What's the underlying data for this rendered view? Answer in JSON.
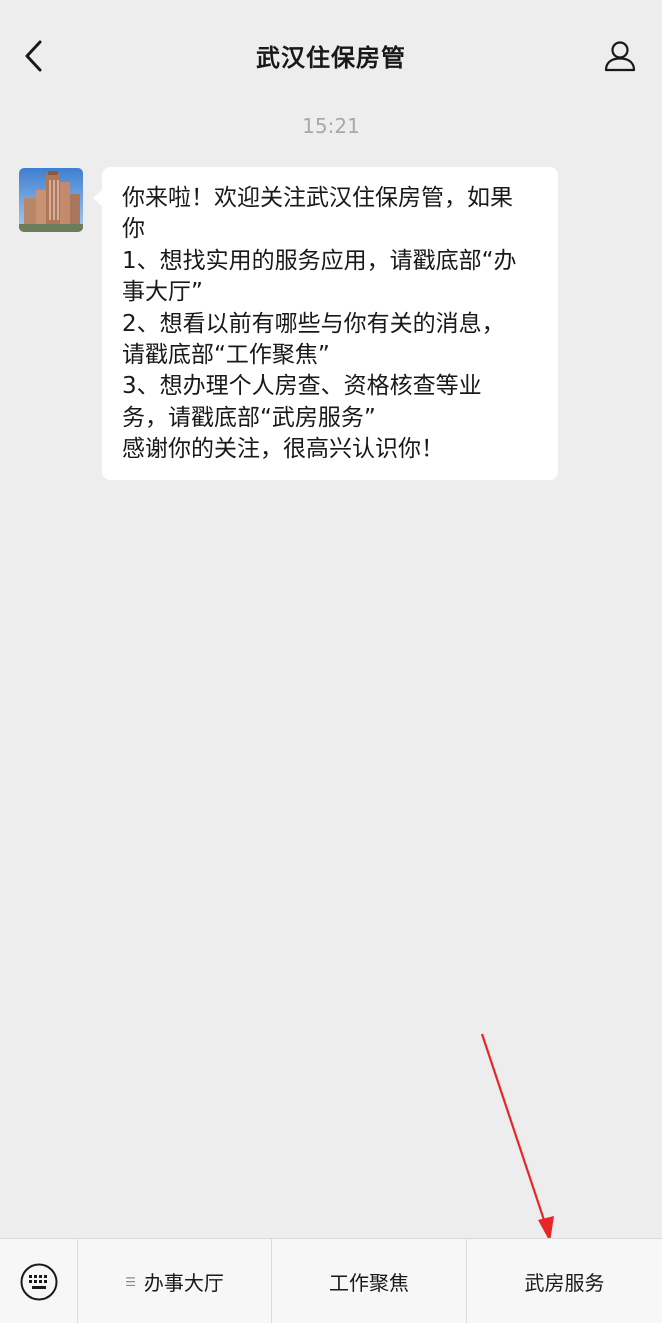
{
  "header": {
    "title": "武汉住保房管",
    "back_icon": "chevron-left-icon",
    "profile_icon": "person-icon"
  },
  "chat": {
    "timestamp": "15:21",
    "message": {
      "lines": [
        "你来啦！欢迎关注武汉住保房管，如果",
        "你",
        "1、想找实用的服务应用，请戳底部“办",
        "事大厅”",
        "2、想看以前有哪些与你有关的消息，",
        "请戳底部“工作聚焦”",
        "3、想办理个人房查、资格核查等业",
        "务，请戳底部“武房服务”",
        "感谢你的关注，很高兴认识你！"
      ]
    }
  },
  "bottom_menu": {
    "keyboard_icon": "keyboard-icon",
    "items": [
      {
        "label": "办事大厅",
        "has_submenu": true
      },
      {
        "label": "工作聚焦",
        "has_submenu": false
      },
      {
        "label": "武房服务",
        "has_submenu": false
      }
    ]
  },
  "colors": {
    "background": "#ededed",
    "bubble": "#ffffff",
    "annotation_arrow": "#e8262a"
  }
}
